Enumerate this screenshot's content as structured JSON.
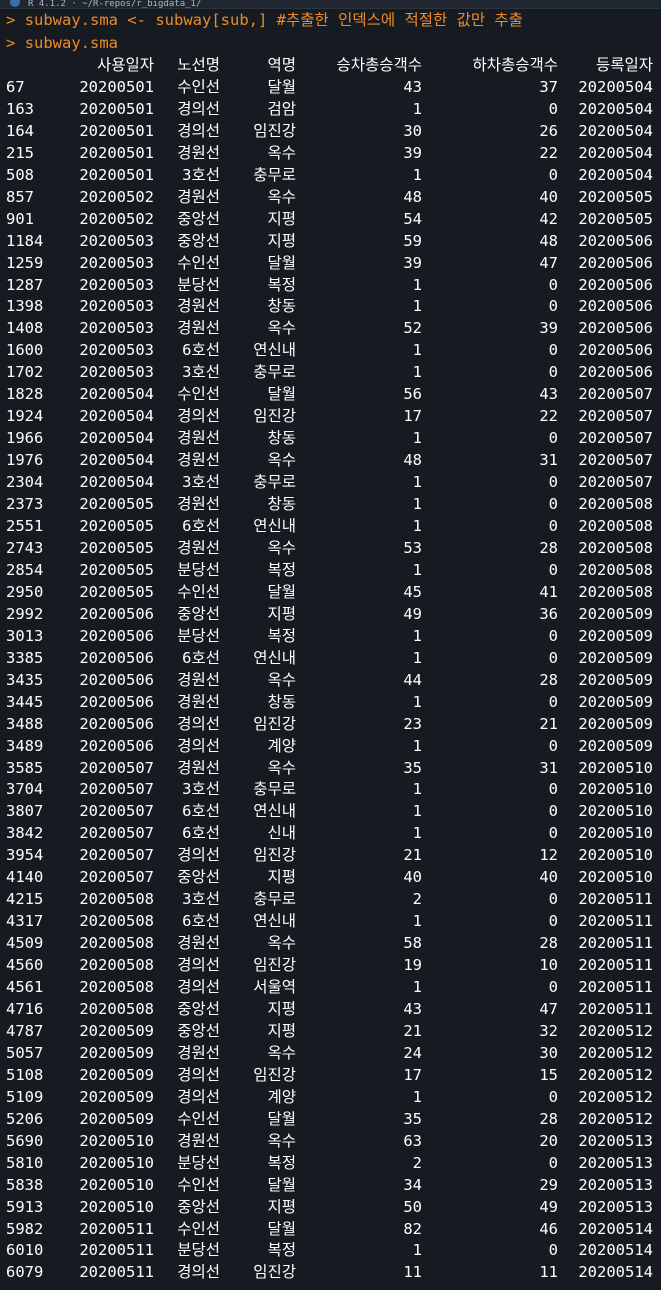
{
  "window": {
    "title": "R 4.1.2 · ~/R-repos/r_bigdata_1/"
  },
  "console": {
    "prompt": ">",
    "commands": [
      "subway.sma <- subway[sub,] #추출한 인덱스에 적절한 값만 추출",
      "subway.sma"
    ],
    "headers": [
      "",
      "사용일자",
      "노선명",
      "역명",
      "승차총승객수",
      "하차총승객수",
      "등록일자"
    ],
    "rows": [
      [
        "67",
        "20200501",
        "수인선",
        "달월",
        "43",
        "37",
        "20200504"
      ],
      [
        "163",
        "20200501",
        "경의선",
        "검암",
        "1",
        "0",
        "20200504"
      ],
      [
        "164",
        "20200501",
        "경의선",
        "임진강",
        "30",
        "26",
        "20200504"
      ],
      [
        "215",
        "20200501",
        "경원선",
        "옥수",
        "39",
        "22",
        "20200504"
      ],
      [
        "508",
        "20200501",
        "3호선",
        "충무로",
        "1",
        "0",
        "20200504"
      ],
      [
        "857",
        "20200502",
        "경원선",
        "옥수",
        "48",
        "40",
        "20200505"
      ],
      [
        "901",
        "20200502",
        "중앙선",
        "지평",
        "54",
        "42",
        "20200505"
      ],
      [
        "1184",
        "20200503",
        "중앙선",
        "지평",
        "59",
        "48",
        "20200506"
      ],
      [
        "1259",
        "20200503",
        "수인선",
        "달월",
        "39",
        "47",
        "20200506"
      ],
      [
        "1287",
        "20200503",
        "분당선",
        "복정",
        "1",
        "0",
        "20200506"
      ],
      [
        "1398",
        "20200503",
        "경원선",
        "창동",
        "1",
        "0",
        "20200506"
      ],
      [
        "1408",
        "20200503",
        "경원선",
        "옥수",
        "52",
        "39",
        "20200506"
      ],
      [
        "1600",
        "20200503",
        "6호선",
        "연신내",
        "1",
        "0",
        "20200506"
      ],
      [
        "1702",
        "20200503",
        "3호선",
        "충무로",
        "1",
        "0",
        "20200506"
      ],
      [
        "1828",
        "20200504",
        "수인선",
        "달월",
        "56",
        "43",
        "20200507"
      ],
      [
        "1924",
        "20200504",
        "경의선",
        "임진강",
        "17",
        "22",
        "20200507"
      ],
      [
        "1966",
        "20200504",
        "경원선",
        "창동",
        "1",
        "0",
        "20200507"
      ],
      [
        "1976",
        "20200504",
        "경원선",
        "옥수",
        "48",
        "31",
        "20200507"
      ],
      [
        "2304",
        "20200504",
        "3호선",
        "충무로",
        "1",
        "0",
        "20200507"
      ],
      [
        "2373",
        "20200505",
        "경원선",
        "창동",
        "1",
        "0",
        "20200508"
      ],
      [
        "2551",
        "20200505",
        "6호선",
        "연신내",
        "1",
        "0",
        "20200508"
      ],
      [
        "2743",
        "20200505",
        "경원선",
        "옥수",
        "53",
        "28",
        "20200508"
      ],
      [
        "2854",
        "20200505",
        "분당선",
        "복정",
        "1",
        "0",
        "20200508"
      ],
      [
        "2950",
        "20200505",
        "수인선",
        "달월",
        "45",
        "41",
        "20200508"
      ],
      [
        "2992",
        "20200506",
        "중앙선",
        "지평",
        "49",
        "36",
        "20200509"
      ],
      [
        "3013",
        "20200506",
        "분당선",
        "복정",
        "1",
        "0",
        "20200509"
      ],
      [
        "3385",
        "20200506",
        "6호선",
        "연신내",
        "1",
        "0",
        "20200509"
      ],
      [
        "3435",
        "20200506",
        "경원선",
        "옥수",
        "44",
        "28",
        "20200509"
      ],
      [
        "3445",
        "20200506",
        "경원선",
        "창동",
        "1",
        "0",
        "20200509"
      ],
      [
        "3488",
        "20200506",
        "경의선",
        "임진강",
        "23",
        "21",
        "20200509"
      ],
      [
        "3489",
        "20200506",
        "경의선",
        "계양",
        "1",
        "0",
        "20200509"
      ],
      [
        "3585",
        "20200507",
        "경원선",
        "옥수",
        "35",
        "31",
        "20200510"
      ],
      [
        "3704",
        "20200507",
        "3호선",
        "충무로",
        "1",
        "0",
        "20200510"
      ],
      [
        "3807",
        "20200507",
        "6호선",
        "연신내",
        "1",
        "0",
        "20200510"
      ],
      [
        "3842",
        "20200507",
        "6호선",
        "신내",
        "1",
        "0",
        "20200510"
      ],
      [
        "3954",
        "20200507",
        "경의선",
        "임진강",
        "21",
        "12",
        "20200510"
      ],
      [
        "4140",
        "20200507",
        "중앙선",
        "지평",
        "40",
        "40",
        "20200510"
      ],
      [
        "4215",
        "20200508",
        "3호선",
        "충무로",
        "2",
        "0",
        "20200511"
      ],
      [
        "4317",
        "20200508",
        "6호선",
        "연신내",
        "1",
        "0",
        "20200511"
      ],
      [
        "4509",
        "20200508",
        "경원선",
        "옥수",
        "58",
        "28",
        "20200511"
      ],
      [
        "4560",
        "20200508",
        "경의선",
        "임진강",
        "19",
        "10",
        "20200511"
      ],
      [
        "4561",
        "20200508",
        "경의선",
        "서울역",
        "1",
        "0",
        "20200511"
      ],
      [
        "4716",
        "20200508",
        "중앙선",
        "지평",
        "43",
        "47",
        "20200511"
      ],
      [
        "4787",
        "20200509",
        "중앙선",
        "지평",
        "21",
        "32",
        "20200512"
      ],
      [
        "5057",
        "20200509",
        "경원선",
        "옥수",
        "24",
        "30",
        "20200512"
      ],
      [
        "5108",
        "20200509",
        "경의선",
        "임진강",
        "17",
        "15",
        "20200512"
      ],
      [
        "5109",
        "20200509",
        "경의선",
        "계양",
        "1",
        "0",
        "20200512"
      ],
      [
        "5206",
        "20200509",
        "수인선",
        "달월",
        "35",
        "28",
        "20200512"
      ],
      [
        "5690",
        "20200510",
        "경원선",
        "옥수",
        "63",
        "20",
        "20200513"
      ],
      [
        "5810",
        "20200510",
        "분당선",
        "복정",
        "2",
        "0",
        "20200513"
      ],
      [
        "5838",
        "20200510",
        "수인선",
        "달월",
        "34",
        "29",
        "20200513"
      ],
      [
        "5913",
        "20200510",
        "중앙선",
        "지평",
        "50",
        "49",
        "20200513"
      ],
      [
        "5982",
        "20200511",
        "수인선",
        "달월",
        "82",
        "46",
        "20200514"
      ],
      [
        "6010",
        "20200511",
        "분당선",
        "복정",
        "1",
        "0",
        "20200514"
      ],
      [
        "6079",
        "20200511",
        "경의선",
        "임진강",
        "11",
        "11",
        "20200514"
      ]
    ]
  },
  "colors": {
    "background": "#161b22",
    "command": "#f08a24",
    "output": "#ffffff"
  }
}
